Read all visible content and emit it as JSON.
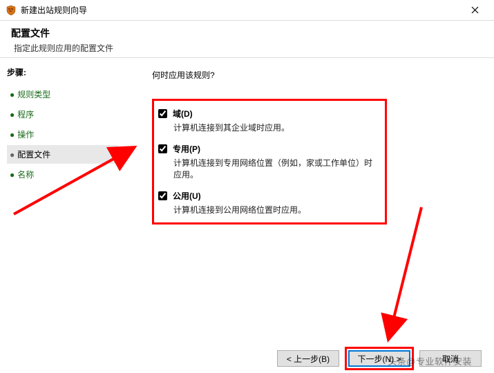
{
  "window": {
    "title": "新建出站规则向导"
  },
  "header": {
    "title": "配置文件",
    "subtitle": "指定此规则应用的配置文件"
  },
  "sidebar": {
    "steps_label": "步骤:",
    "items": [
      {
        "label": "规则类型",
        "active": false
      },
      {
        "label": "程序",
        "active": false
      },
      {
        "label": "操作",
        "active": false
      },
      {
        "label": "配置文件",
        "active": true
      },
      {
        "label": "名称",
        "active": false
      }
    ]
  },
  "content": {
    "question": "何时应用该规则?",
    "options": [
      {
        "label": "域(D)",
        "desc": "计算机连接到其企业域时应用。",
        "checked": true
      },
      {
        "label": "专用(P)",
        "desc": "计算机连接到专用网络位置（例如，家或工作单位）时应用。",
        "checked": true
      },
      {
        "label": "公用(U)",
        "desc": "计算机连接到公用网络位置时应用。",
        "checked": true
      }
    ]
  },
  "footer": {
    "back": "< 上一步(B)",
    "next": "下一步(N) >",
    "cancel": "取消"
  },
  "watermark": "头条@专业软件安装"
}
